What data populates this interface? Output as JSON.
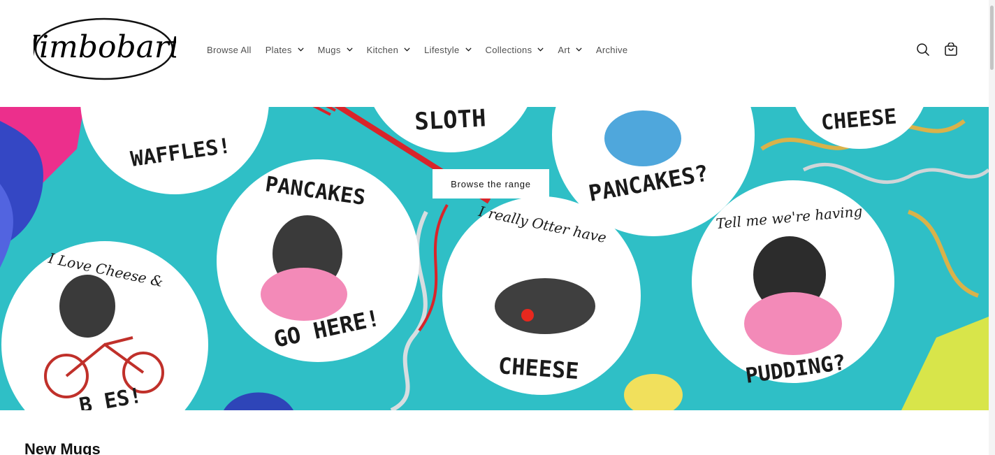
{
  "brand": {
    "name": "Jimbobart"
  },
  "nav": {
    "items": [
      {
        "label": "Browse All",
        "dropdown": false
      },
      {
        "label": "Plates",
        "dropdown": true
      },
      {
        "label": "Mugs",
        "dropdown": true
      },
      {
        "label": "Kitchen",
        "dropdown": true
      },
      {
        "label": "Lifestyle",
        "dropdown": true
      },
      {
        "label": "Collections",
        "dropdown": true
      },
      {
        "label": "Art",
        "dropdown": true
      },
      {
        "label": "Archive",
        "dropdown": false
      }
    ]
  },
  "header_icons": {
    "search": "search-icon",
    "cart": "cart-icon"
  },
  "hero": {
    "button_label": "Browse the range",
    "background_color": "#2fbfc6",
    "plate_texts": {
      "waffles": "WAFFLES!",
      "sloth": "SLOTH",
      "pancakes_top": "PANCAKES?",
      "cheese_top": "CHEESE",
      "pancakes": "PANCAKES",
      "go_here": "GO HERE!",
      "love_cheese": "I Love Cheese &",
      "bikes": "B  ES!",
      "otter_line1": "I really Otter have",
      "cheese": "CHEESE",
      "red_panda_line1": "Tell me we're having",
      "pudding": "PUDDING?"
    }
  },
  "section": {
    "title": "New Mugs"
  }
}
